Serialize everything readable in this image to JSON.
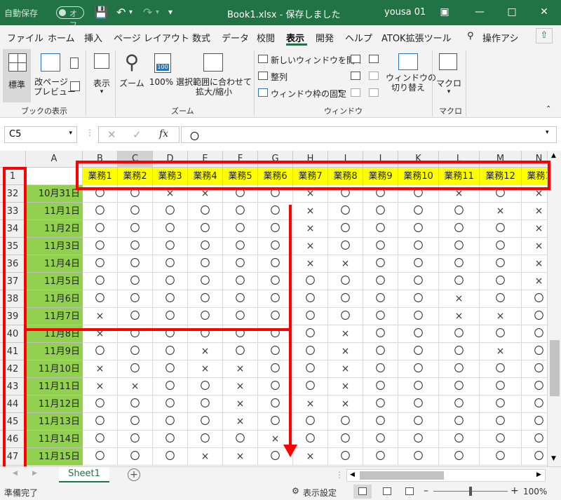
{
  "title": {
    "autosave": "自動保存",
    "toggle": "オフ",
    "document": "Book1.xlsx  -  保存しました",
    "user": "yousa 01"
  },
  "menu": [
    "ファイル",
    "ホーム",
    "挿入",
    "ページ レイアウト",
    "数式",
    "データ",
    "校閲",
    "表示",
    "開発",
    "ヘルプ",
    "ATOK拡張ツール",
    "操作アシ"
  ],
  "ribbon": {
    "normal": "標準",
    "pagebreak": "改ページ\nプレビュー",
    "display": "表示",
    "zoom": "ズーム",
    "zoom100": "100%",
    "zoomsel": "選択範囲に合わせて\n拡大/縮小",
    "newwin": "新しいウィンドウを開く",
    "arrange": "整列",
    "freeze": "ウィンドウ枠の固定",
    "switchwin": "ウィンドウの\n切り替え",
    "macro": "マクロ",
    "groups": [
      "ブックの表示",
      "ズーム",
      "ウィンドウ",
      "マクロ"
    ]
  },
  "formula": {
    "namebox": "C5",
    "content": "〇"
  },
  "columns": [
    "A",
    "B",
    "C",
    "D",
    "E",
    "F",
    "G",
    "H",
    "I",
    "J",
    "K",
    "L",
    "M",
    "N"
  ],
  "header_row": {
    "number": "1",
    "tasks": [
      "業務1",
      "業務2",
      "業務3",
      "業務4",
      "業務5",
      "業務6",
      "業務7",
      "業務8",
      "業務9",
      "業務10",
      "業務11",
      "業務12",
      "業務1"
    ]
  },
  "rows": [
    {
      "num": "32",
      "date": "10月31日",
      "marks": [
        "〇",
        "〇",
        "×",
        "×",
        "〇",
        "〇",
        "×",
        "〇",
        "〇",
        "〇",
        "×",
        "〇",
        "×"
      ]
    },
    {
      "num": "33",
      "date": "11月1日",
      "marks": [
        "〇",
        "〇",
        "〇",
        "〇",
        "〇",
        "〇",
        "×",
        "〇",
        "〇",
        "〇",
        "〇",
        "×",
        "×"
      ]
    },
    {
      "num": "34",
      "date": "11月2日",
      "marks": [
        "〇",
        "〇",
        "〇",
        "〇",
        "〇",
        "〇",
        "×",
        "〇",
        "〇",
        "〇",
        "〇",
        "〇",
        "×"
      ]
    },
    {
      "num": "35",
      "date": "11月3日",
      "marks": [
        "〇",
        "〇",
        "〇",
        "〇",
        "〇",
        "〇",
        "×",
        "〇",
        "〇",
        "〇",
        "〇",
        "〇",
        "×"
      ]
    },
    {
      "num": "36",
      "date": "11月4日",
      "marks": [
        "〇",
        "〇",
        "〇",
        "〇",
        "〇",
        "〇",
        "×",
        "×",
        "〇",
        "〇",
        "〇",
        "〇",
        "×"
      ]
    },
    {
      "num": "37",
      "date": "11月5日",
      "marks": [
        "〇",
        "〇",
        "〇",
        "〇",
        "〇",
        "〇",
        "〇",
        "〇",
        "〇",
        "〇",
        "〇",
        "〇",
        "×"
      ]
    },
    {
      "num": "38",
      "date": "11月6日",
      "marks": [
        "〇",
        "〇",
        "〇",
        "〇",
        "〇",
        "〇",
        "〇",
        "〇",
        "〇",
        "〇",
        "×",
        "〇",
        "〇"
      ]
    },
    {
      "num": "39",
      "date": "11月7日",
      "marks": [
        "×",
        "〇",
        "〇",
        "〇",
        "〇",
        "〇",
        "〇",
        "〇",
        "〇",
        "〇",
        "×",
        "×",
        "〇"
      ]
    },
    {
      "num": "40",
      "date": "11月8日",
      "marks": [
        "×",
        "〇",
        "〇",
        "〇",
        "〇",
        "〇",
        "〇",
        "×",
        "〇",
        "〇",
        "〇",
        "〇",
        "〇"
      ]
    },
    {
      "num": "41",
      "date": "11月9日",
      "marks": [
        "〇",
        "〇",
        "〇",
        "×",
        "〇",
        "〇",
        "〇",
        "×",
        "〇",
        "〇",
        "〇",
        "×",
        "〇"
      ]
    },
    {
      "num": "42",
      "date": "11月10日",
      "marks": [
        "×",
        "〇",
        "〇",
        "×",
        "×",
        "〇",
        "〇",
        "×",
        "〇",
        "〇",
        "〇",
        "〇",
        "〇"
      ]
    },
    {
      "num": "43",
      "date": "11月11日",
      "marks": [
        "×",
        "×",
        "〇",
        "〇",
        "×",
        "〇",
        "〇",
        "×",
        "〇",
        "〇",
        "〇",
        "〇",
        "〇"
      ]
    },
    {
      "num": "44",
      "date": "11月12日",
      "marks": [
        "〇",
        "〇",
        "〇",
        "〇",
        "×",
        "〇",
        "×",
        "×",
        "〇",
        "〇",
        "〇",
        "〇",
        "〇"
      ]
    },
    {
      "num": "45",
      "date": "11月13日",
      "marks": [
        "〇",
        "〇",
        "〇",
        "〇",
        "×",
        "〇",
        "〇",
        "〇",
        "〇",
        "〇",
        "〇",
        "〇",
        "〇"
      ]
    },
    {
      "num": "46",
      "date": "11月14日",
      "marks": [
        "〇",
        "〇",
        "〇",
        "〇",
        "〇",
        "×",
        "〇",
        "〇",
        "〇",
        "〇",
        "〇",
        "〇",
        "〇"
      ]
    },
    {
      "num": "47",
      "date": "11月15日",
      "marks": [
        "〇",
        "〇",
        "〇",
        "×",
        "×",
        "〇",
        "×",
        "〇",
        "〇",
        "〇",
        "〇",
        "〇",
        "〇"
      ]
    }
  ],
  "sheet": {
    "tab": "Sheet1"
  },
  "status": {
    "ready": "準備完了",
    "display_settings": "表示設定",
    "zoom": "100%"
  },
  "colors": {
    "excel_green": "#217346",
    "date_fill": "#92d050",
    "header_fill": "#ffff00",
    "annotation": "#ff0000"
  }
}
